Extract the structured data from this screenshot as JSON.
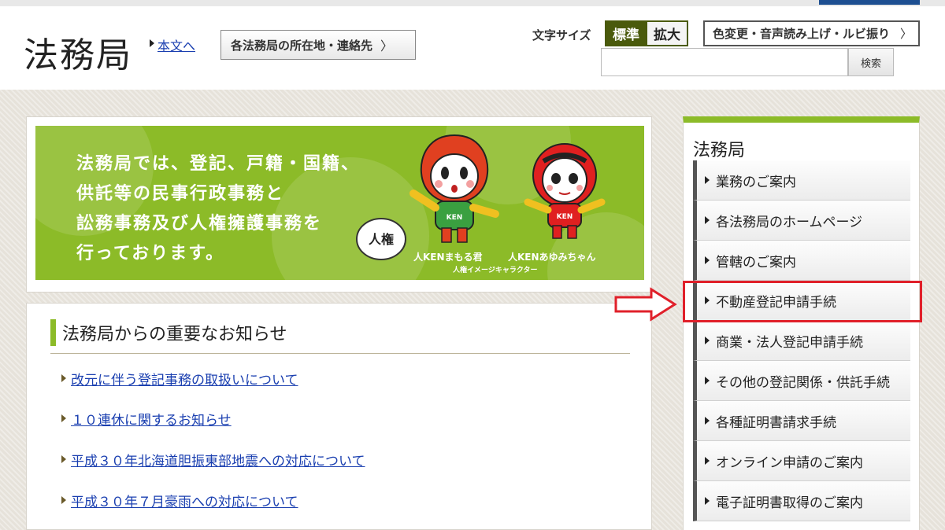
{
  "header": {
    "site_title": "法務局",
    "skip_link": "本文へ",
    "locations_button": "各法務局の所在地・連絡先",
    "chevron": "〉",
    "font_size_label": "文字サイズ",
    "font_size_standard": "標準",
    "font_size_large": "拡大",
    "accessibility_button": "色変更・音声読み上げ・ルビ振り",
    "search_button": "検索",
    "search_placeholder": ""
  },
  "banner": {
    "lines": [
      "法務局では、登記、戸籍・国籍、",
      "供託等の民事行政事務と",
      "訟務事務及び人権擁護事務を",
      "行っております。"
    ],
    "character_1_name": "人KENまもる君",
    "character_2_name": "人KENあゆみちゃん",
    "character_caption": "人権イメージキャラクター",
    "shirt_text": "KEN",
    "seal_text": "人権"
  },
  "news": {
    "heading": "法務局からの重要なお知らせ",
    "items": [
      "改元に伴う登記事務の取扱いについて",
      "１０連休に関するお知らせ",
      "平成３０年北海道胆振東部地震への対応について",
      "平成３０年７月豪雨への対応について"
    ]
  },
  "sidebar": {
    "title": "法務局",
    "items": [
      "業務のご案内",
      "各法務局のホームページ",
      "管轄のご案内",
      "不動産登記申請手続",
      "商業・法人登記申請手続",
      "その他の登記関係・供託手続",
      "各種証明書請求手続",
      "オンライン申請のご案内",
      "電子証明書取得のご案内"
    ],
    "highlighted_index": 3
  },
  "colors": {
    "accent_green": "#8cbb28",
    "dark_olive": "#4a5a0c",
    "link_blue": "#1a3fb0",
    "highlight_red": "#e0202a"
  }
}
